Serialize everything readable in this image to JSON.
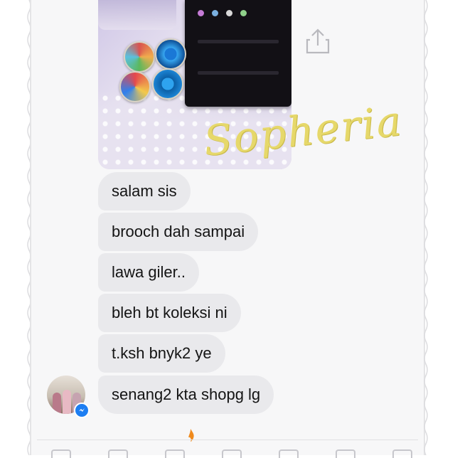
{
  "conversation": {
    "messages": [
      {
        "text": "salam sis"
      },
      {
        "text": "brooch dah sampai"
      },
      {
        "text": "lawa giler.."
      },
      {
        "text": "bleh bt koleksi ni"
      },
      {
        "text": "t.ksh bnyk2 ye"
      },
      {
        "text": "senang2 kta shopg lg"
      }
    ]
  },
  "watermark": {
    "text": "Sopheria",
    "color": "#e6d86a"
  },
  "icons": {
    "share": "share-icon",
    "messenger_badge": "messenger-badge-icon",
    "avatar": "contact-avatar"
  },
  "colors": {
    "bubble_background": "#e9e9ec",
    "bubble_text": "#141414",
    "messenger_blue": "#1d7ef2"
  }
}
